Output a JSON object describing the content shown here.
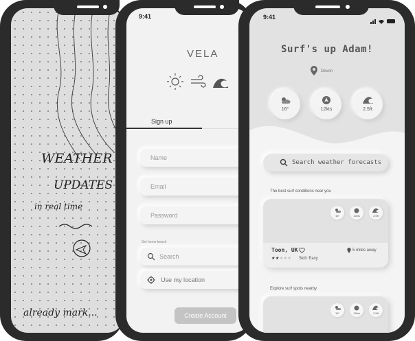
{
  "sketch": {
    "lines": [
      "WEATHER",
      "UPDATES",
      "in real time",
      "already mark..."
    ]
  },
  "signup": {
    "time": "9:41",
    "brand": "VELA",
    "tab_signup": "Sign up",
    "name_placeholder": "Name",
    "email_placeholder": "Email",
    "password_placeholder": "Password",
    "home_beach_label": "Set home beach",
    "search_placeholder": "Search",
    "use_location": "Use my location",
    "create_account": "Create Account"
  },
  "home": {
    "time": "9:41",
    "greeting": "Surf's up Adam!",
    "location": "Devon",
    "stats": [
      {
        "icon": "sun-cloud-icon",
        "value": "16°"
      },
      {
        "icon": "wind-compass-icon",
        "value": "12kts"
      },
      {
        "icon": "wave-icon",
        "value": "2.5ft"
      }
    ],
    "search_placeholder": "Search weather forecasts",
    "best_label": "The best surf conditions near you",
    "card": {
      "mini": [
        "16°",
        "12kts",
        "2.5ft"
      ],
      "title": "Toon, UK",
      "distance": "5 miles away",
      "skill": "Skill: Easy",
      "rating": 2,
      "rating_max": 5
    },
    "explore_label": "Explore surf spots nearby"
  }
}
